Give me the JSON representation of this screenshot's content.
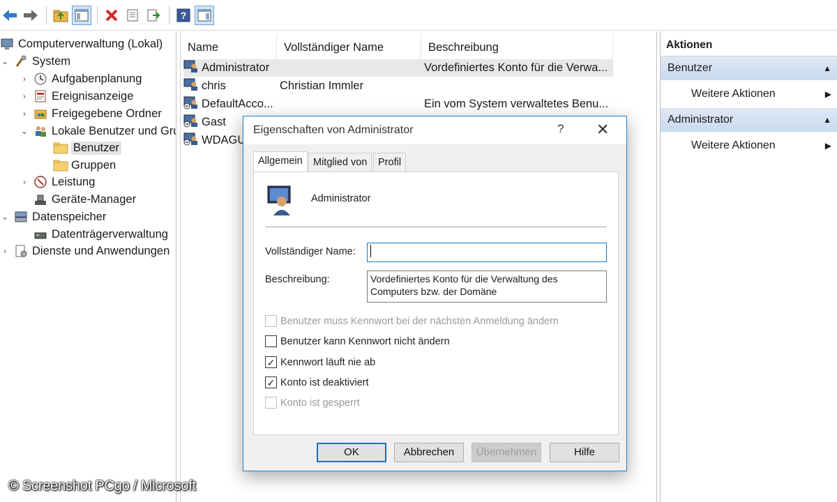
{
  "toolbar": {
    "buttons": [
      "back-arrow-icon",
      "forward-arrow-icon",
      "folder-up-icon",
      "show-hide-tree-icon",
      "delete-icon",
      "properties-icon",
      "export-list-icon",
      "help-icon",
      "show-hide-action-pane-icon"
    ]
  },
  "tree": {
    "root": "Computerverwaltung (Lokal)",
    "items": [
      {
        "label": "System",
        "arrow": "⌄"
      },
      {
        "label": "Aufgabenplanung",
        "arrow": "›"
      },
      {
        "label": "Ereignisanzeige",
        "arrow": "›"
      },
      {
        "label": "Freigegebene Ordner",
        "arrow": "›"
      },
      {
        "label": "Lokale Benutzer und Gruppen",
        "arrow": "⌄"
      },
      {
        "label": "Benutzer",
        "arrow": ""
      },
      {
        "label": "Gruppen",
        "arrow": ""
      },
      {
        "label": "Leistung",
        "arrow": "›"
      },
      {
        "label": "Geräte-Manager",
        "arrow": ""
      },
      {
        "label": "Datenspeicher",
        "arrow": "⌄"
      },
      {
        "label": "Datenträgerverwaltung",
        "arrow": ""
      },
      {
        "label": "Dienste und Anwendungen",
        "arrow": "›"
      }
    ]
  },
  "list": {
    "columns": [
      "Name",
      "Vollständiger Name",
      "Beschreibung"
    ],
    "rows": [
      {
        "name": "Administrator",
        "full_name": "",
        "description": "Vordefiniertes Konto für die Verwa..."
      },
      {
        "name": "chris",
        "full_name": "Christian Immler",
        "description": ""
      },
      {
        "name": "DefaultAcco...",
        "full_name": "",
        "description": "Ein vom System verwaltetes Benu..."
      },
      {
        "name": "Gast",
        "full_name": "",
        "description": ""
      },
      {
        "name": "WDAGU",
        "full_name": "",
        "description": ""
      }
    ]
  },
  "actions": {
    "title": "Aktionen",
    "section1": "Benutzer",
    "section1_item": "Weitere Aktionen",
    "section2": "Administrator",
    "section2_item": "Weitere Aktionen"
  },
  "dialog": {
    "title": "Eigenschaften von Administrator",
    "help": "?",
    "close": "✕",
    "tabs": [
      "Allgemein",
      "Mitglied von",
      "Profil"
    ],
    "user_name": "Administrator",
    "full_name_label": "Vollständiger Name:",
    "full_name_value": "",
    "description_label": "Beschreibung:",
    "description_value": "Vordefiniertes Konto für die Verwaltung des Computers bzw. der Domäne",
    "checkboxes": [
      {
        "label": "Benutzer muss Kennwort bei der nächsten Anmeldung ändern",
        "checked": false,
        "disabled": true
      },
      {
        "label": "Benutzer kann Kennwort nicht ändern",
        "checked": false,
        "disabled": false
      },
      {
        "label": "Kennwort läuft nie ab",
        "checked": true,
        "disabled": false
      },
      {
        "label": "Konto ist deaktiviert",
        "checked": true,
        "disabled": false
      },
      {
        "label": "Konto ist gesperrt",
        "checked": false,
        "disabled": true
      }
    ],
    "buttons": {
      "ok": "OK",
      "cancel": "Abbrechen",
      "apply": "Übernehmen",
      "help": "Hilfe"
    }
  },
  "watermark": "© Screenshot PCgo / Microsoft"
}
